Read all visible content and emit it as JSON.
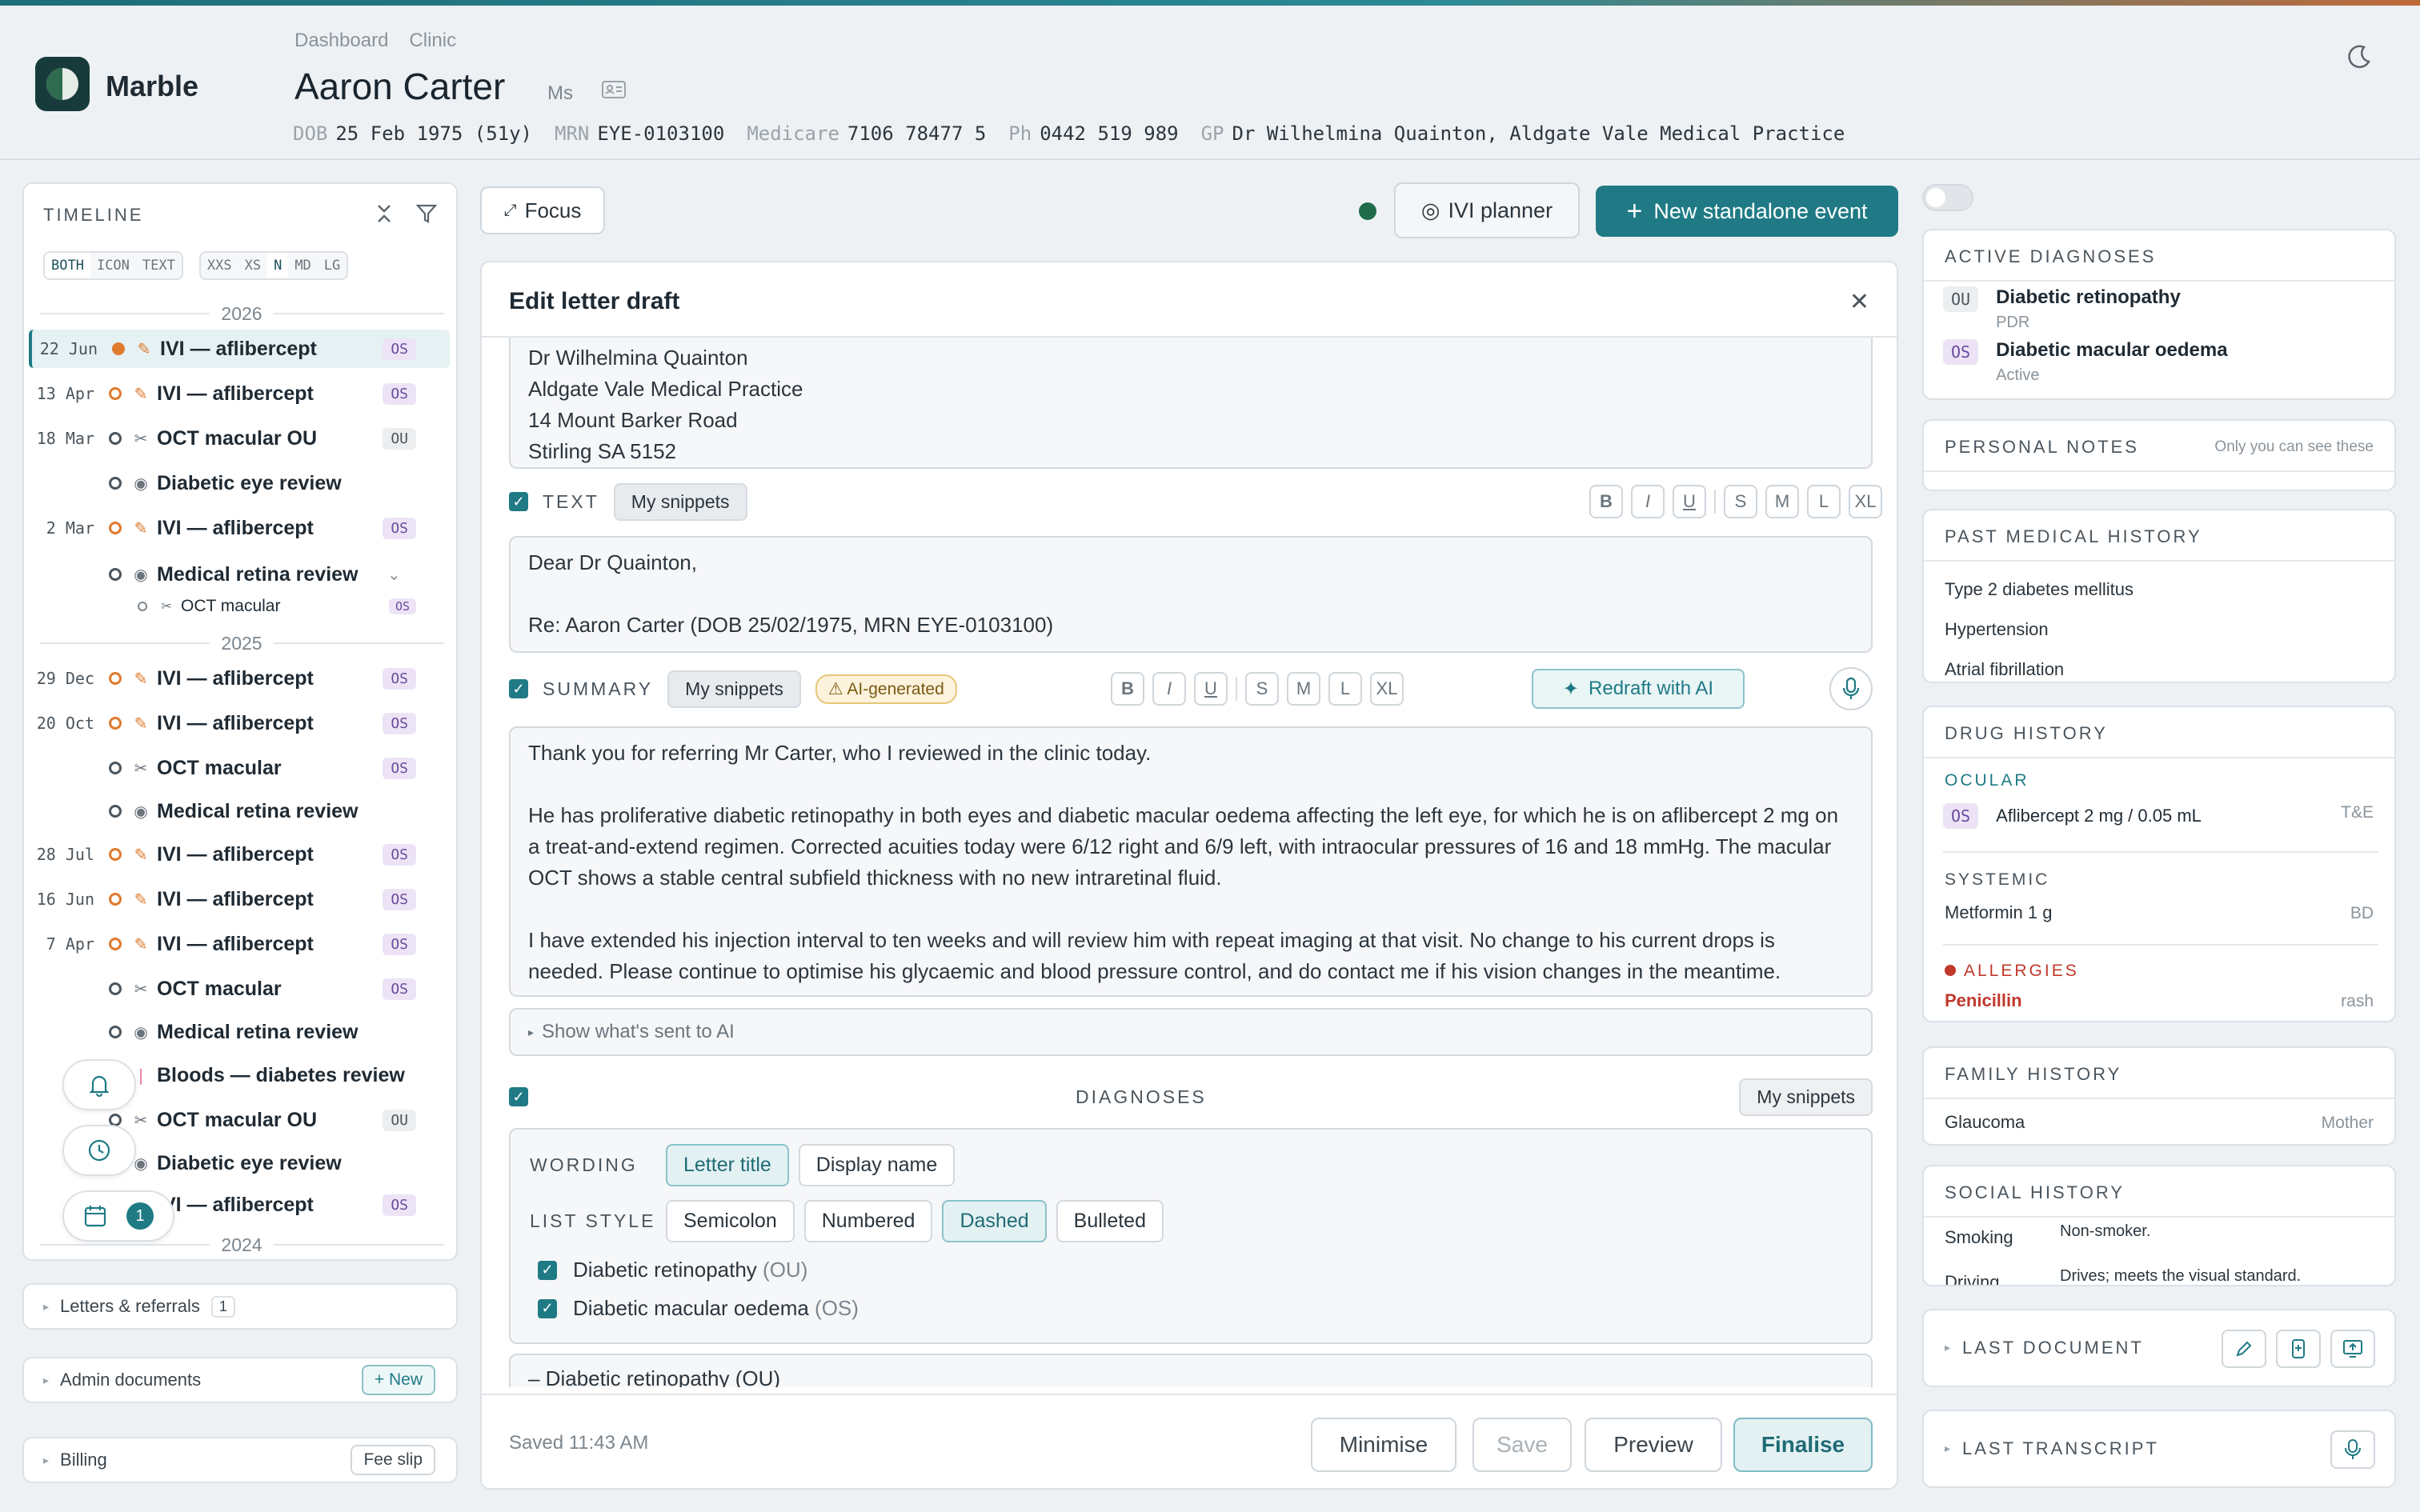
{
  "app": {
    "name": "Marble"
  },
  "breadcrumb": [
    "Dashboard",
    "Clinic"
  ],
  "patient": {
    "name": "Aaron Carter",
    "title": "Ms",
    "dob_label": "DOB",
    "dob": "25 Feb 1975 (51y)",
    "mrn_label": "MRN",
    "mrn": "EYE-0103100",
    "medicare_label": "Medicare",
    "medicare": "7106 78477 5",
    "ph_label": "Ph",
    "ph": "0442 519 989",
    "gp_label": "GP",
    "gp": "Dr Wilhelmina Quainton, Aldgate Vale Medical Practice"
  },
  "timeline": {
    "heading": "TIMELINE",
    "mode_toggle": [
      "BOTH",
      "ICON",
      "TEXT"
    ],
    "size_toggle": [
      "XXS",
      "XS",
      "N",
      "MD",
      "LG"
    ],
    "years": [
      "2026",
      "2025",
      "2024"
    ],
    "events": [
      {
        "date": "22 Jun",
        "title": "IVI — aflibercept",
        "eye": "OS"
      },
      {
        "date": "13 Apr",
        "title": "IVI — aflibercept",
        "eye": "OS"
      },
      {
        "date": "18 Mar",
        "title": "OCT macular OU",
        "eye": "OU"
      },
      {
        "date": "",
        "title": "Diabetic eye review",
        "eye": ""
      },
      {
        "date": "2 Mar",
        "title": "IVI — aflibercept",
        "eye": "OS"
      },
      {
        "date": "",
        "title": "Medical retina review",
        "eye": ""
      },
      {
        "date": "",
        "title": "OCT macular",
        "eye": "OS"
      },
      {
        "date": "29 Dec",
        "title": "IVI — aflibercept",
        "eye": "OS"
      },
      {
        "date": "20 Oct",
        "title": "IVI — aflibercept",
        "eye": "OS"
      },
      {
        "date": "",
        "title": "OCT macular",
        "eye": "OS"
      },
      {
        "date": "",
        "title": "Medical retina review",
        "eye": ""
      },
      {
        "date": "28 Jul",
        "title": "IVI — aflibercept",
        "eye": "OS"
      },
      {
        "date": "16 Jun",
        "title": "IVI — aflibercept",
        "eye": "OS"
      },
      {
        "date": "7 Apr",
        "title": "IVI — aflibercept",
        "eye": "OS"
      },
      {
        "date": "",
        "title": "OCT macular",
        "eye": "OS"
      },
      {
        "date": "",
        "title": "Medical retina review",
        "eye": ""
      },
      {
        "date": "",
        "title": "Bloods — diabetes review",
        "eye": ""
      },
      {
        "date": "",
        "title": "OCT macular OU",
        "eye": "OU"
      },
      {
        "date": "",
        "title": "Diabetic eye review",
        "eye": ""
      },
      {
        "date": "",
        "title": "IVI — aflibercept",
        "eye": "OS"
      }
    ],
    "calendar_count": "1"
  },
  "left_sections": {
    "letters": {
      "label": "Letters & referrals",
      "count": "1"
    },
    "admin": {
      "label": "Admin documents",
      "button": "+ New"
    },
    "billing": {
      "label": "Billing",
      "button": "Fee slip"
    }
  },
  "toolbar": {
    "focus": "Focus",
    "ivi_planner": "IVI planner",
    "new_event": "New standalone event"
  },
  "letter": {
    "title": "Edit letter draft",
    "address": [
      "Dr Wilhelmina Quainton",
      "Aldgate Vale Medical Practice",
      "14 Mount Barker Road",
      "Stirling SA 5152"
    ],
    "text_section": {
      "label": "TEXT",
      "snippets": "My snippets",
      "content": [
        "Dear Dr Quainton,",
        "",
        "Re: Aaron Carter (DOB 25/02/1975, MRN EYE-0103100)"
      ]
    },
    "format_buttons": [
      "B",
      "I",
      "U",
      "S",
      "M",
      "L",
      "XL"
    ],
    "summary_section": {
      "label": "SUMMARY",
      "snippets": "My snippets",
      "ai_badge": "⚠ AI-generated",
      "redraft": "Redraft with AI",
      "content": [
        "Thank you for referring Mr Carter, who I reviewed in the clinic today.",
        "",
        "He has proliferative diabetic retinopathy in both eyes and diabetic macular oedema affecting the left eye, for which he is on aflibercept 2 mg on a treat-and-extend regimen. Corrected acuities today were 6/12 right and 6/9 left, with intraocular pressures of 16 and 18 mmHg. The macular OCT shows a stable central subfield thickness with no new intraretinal fluid.",
        "",
        "I have extended his injection interval to ten weeks and will review him with repeat imaging at that visit. No change to his current drops is needed. Please continue to optimise his glycaemic and blood pressure control, and do contact me if his vision changes in the meantime."
      ]
    },
    "show_ai": "Show what's sent to AI",
    "diagnoses_section": {
      "label": "DIAGNOSES",
      "snippets": "My snippets",
      "wording_label": "WORDING",
      "wording_options": [
        "Letter title",
        "Display name"
      ],
      "wording_selected": "Letter title",
      "list_label": "LIST STYLE",
      "list_options": [
        "Semicolon",
        "Numbered",
        "Dashed",
        "Bulleted"
      ],
      "list_selected": "Dashed",
      "items": [
        {
          "name": "Diabetic retinopathy",
          "eye": "(OU)"
        },
        {
          "name": "Diabetic macular oedema",
          "eye": "(OS)"
        }
      ],
      "preview": "– Diabetic retinopathy (OU)"
    },
    "footer": {
      "saved": "Saved 11:43 AM",
      "minimise": "Minimise",
      "save": "Save",
      "preview": "Preview",
      "finalise": "Finalise"
    }
  },
  "right": {
    "active_diagnoses": {
      "heading": "ACTIVE DIAGNOSES",
      "items": [
        {
          "eye": "OU",
          "name": "Diabetic retinopathy",
          "sub": "PDR"
        },
        {
          "eye": "OS",
          "name": "Diabetic macular oedema",
          "sub": "Active"
        }
      ]
    },
    "personal_notes": {
      "heading": "PERSONAL NOTES",
      "hint": "Only you can see these"
    },
    "pmh": {
      "heading": "PAST MEDICAL HISTORY",
      "items": [
        "Type 2 diabetes mellitus",
        "Hypertension",
        "Atrial fibrillation"
      ]
    },
    "drug_history": {
      "heading": "DRUG HISTORY",
      "ocular_label": "OCULAR",
      "ocular": {
        "eye": "OS",
        "name": "Aflibercept 2 mg / 0.05 mL",
        "freq": "T&E"
      },
      "systemic_label": "SYSTEMIC",
      "systemic": {
        "name": "Metformin 1 g",
        "freq": "BD"
      },
      "allergies_label": "ALLERGIES",
      "allergy": {
        "name": "Penicillin",
        "reaction": "rash"
      }
    },
    "family_history": {
      "heading": "FAMILY HISTORY",
      "item": "Glaucoma",
      "relation": "Mother"
    },
    "social_history": {
      "heading": "SOCIAL HISTORY",
      "rows": [
        {
          "k": "Smoking",
          "v": "Non-smoker."
        },
        {
          "k": "Driving",
          "v": "Drives; meets the visual standard."
        }
      ]
    },
    "last_document": "LAST DOCUMENT",
    "last_transcript": "LAST TRANSCRIPT"
  },
  "colors": {
    "accent": "#1f7a85",
    "ivi": "#e07a2e",
    "os_badge": "#ece4f6",
    "allergy": "#c0392b"
  }
}
